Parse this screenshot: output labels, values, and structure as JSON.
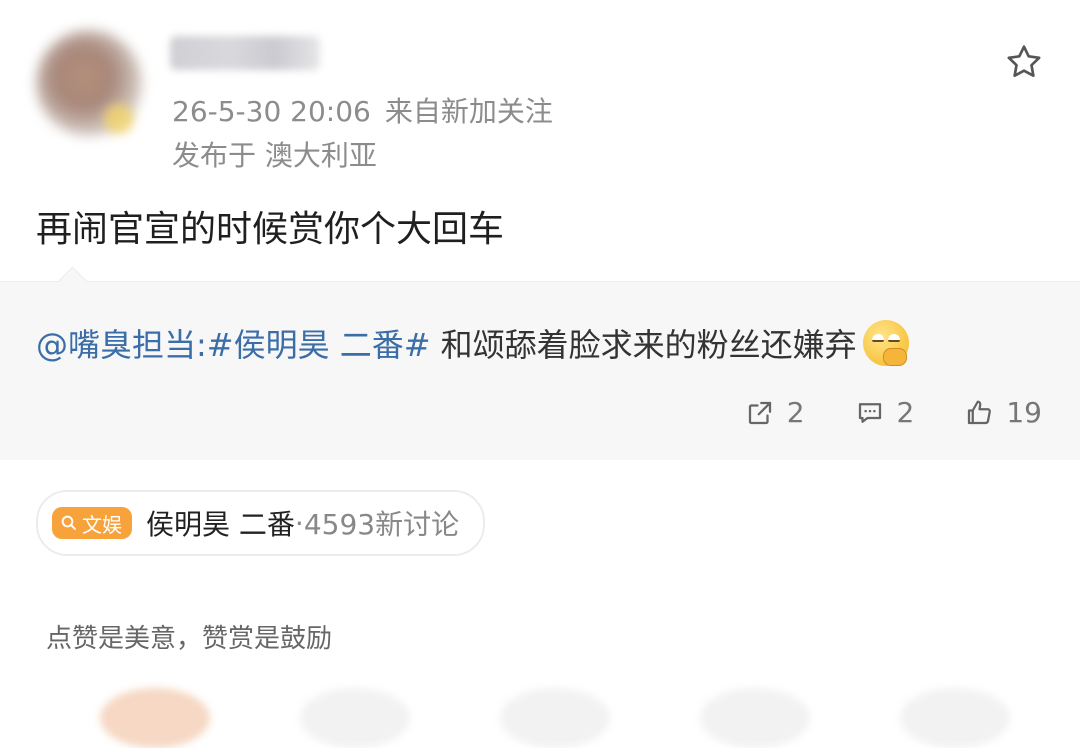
{
  "author": {
    "name": "",
    "time": "26-5-30 20:06",
    "source": "来自新加关注",
    "location": "发布于 澳大利亚"
  },
  "post": {
    "text": "再闹官宣的时候赏你个大回车"
  },
  "repost": {
    "prefix": "@嘴臭担当:",
    "hashtag": "#侯明昊 二番#",
    "text": "和颂舔着脸求来的粉丝还嫌弃",
    "emoji": "thinking-face-emoji"
  },
  "actions": {
    "share_count": "2",
    "comment_count": "2",
    "like_count": "19"
  },
  "topic": {
    "badge": "文娱",
    "title": "侯明昊 二番",
    "separator": "·",
    "count": "4593新讨论"
  },
  "reward": {
    "hint": "点赞是美意，赞赏是鼓励"
  },
  "colors": {
    "link": "#3b6ea8",
    "badge": "#f7a23b",
    "meta": "#8c8c8c",
    "repost_bg": "#f7f7f7"
  },
  "icons": [
    "star-icon",
    "share-icon",
    "comment-icon",
    "like-icon",
    "search-icon"
  ]
}
